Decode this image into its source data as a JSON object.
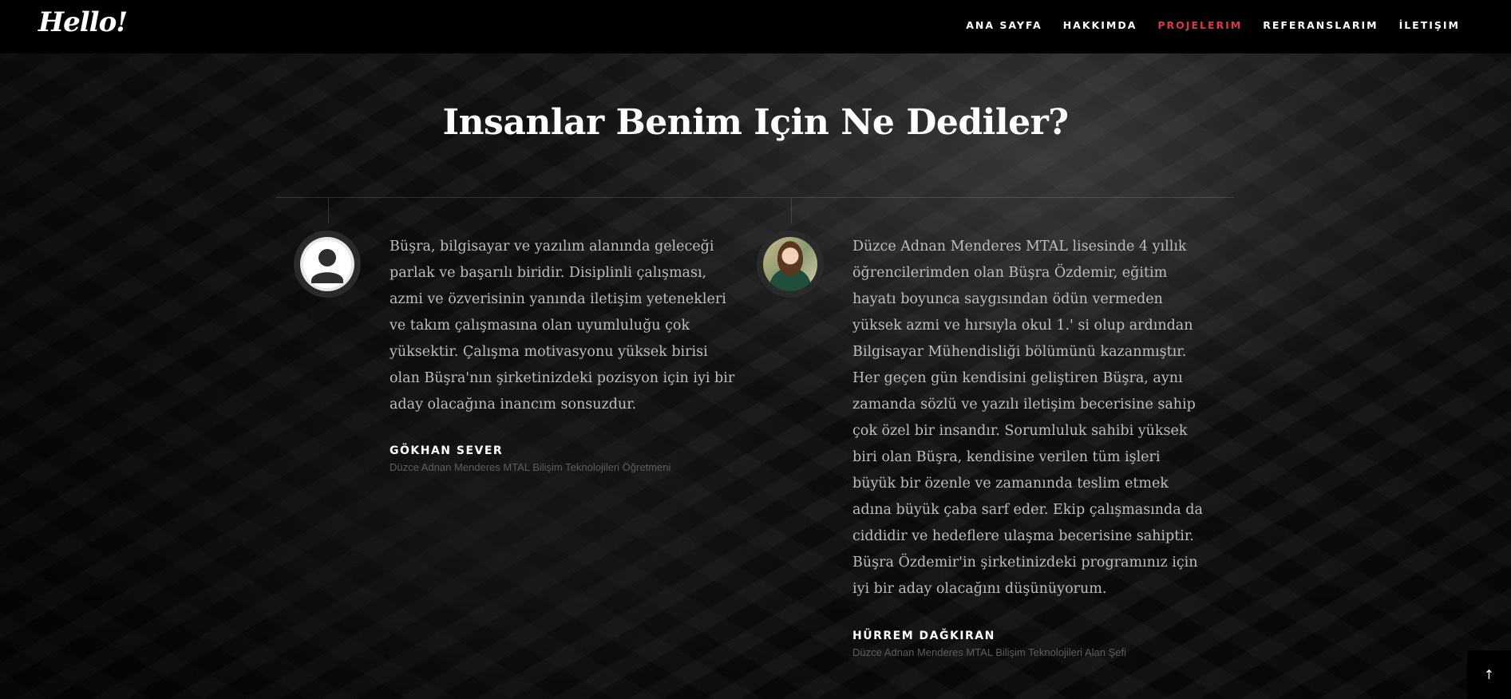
{
  "header": {
    "logo": "Hello!",
    "nav": [
      {
        "label": "ANA SAYFA",
        "active": false
      },
      {
        "label": "HAKKIMDA",
        "active": false
      },
      {
        "label": "PROJELERIM",
        "active": true
      },
      {
        "label": "REFERANSLARIM",
        "active": false
      },
      {
        "label": "İLETIŞIM",
        "active": false
      }
    ],
    "active_color": "#e0353b"
  },
  "section": {
    "title": "Insanlar Benim Için Ne Dediler?"
  },
  "testimonials": [
    {
      "avatar": "default-user-icon",
      "text": "Büşra, bilgisayar ve yazılım alanında geleceği parlak ve başarılı biridir. Disiplinli çalışması, azmi ve özverisinin yanında iletişim yetenekleri ve takım çalışmasına olan uyumluluğu çok yüksektir. Çalışma motivasyonu yüksek birisi olan Büşra'nın şirketinizdeki pozisyon için iyi bir aday olacağına inancım sonsuzdur.",
      "name": "GÖKHAN SEVER",
      "role": "Düzce Adnan Menderes MTAL Bilişim Teknolojileri Öğretmeni"
    },
    {
      "avatar": "profile-photo",
      "text": "Düzce Adnan Menderes MTAL lisesinde 4 yıllık öğrencilerimden olan Büşra Özdemir, eğitim hayatı boyunca saygısından ödün vermeden yüksek azmi ve hırsıyla okul 1.' si olup ardından Bilgisayar Mühendisliği bölümünü kazanmıştır. Her geçen gün kendisini geliştiren Büşra, aynı zamanda sözlü ve yazılı iletişim becerisine sahip çok özel bir insandır. Sorumluluk sahibi yüksek biri olan Büşra, kendisine verilen tüm işleri büyük bir özenle ve zamanında teslim etmek adına büyük çaba sarf eder. Ekip çalışmasında da ciddidir ve hedeflere ulaşma becerisine sahiptir. Büşra Özdemir'in şirketinizdeki programınız için iyi bir aday olacağını düşünüyorum.",
      "name": "HÜRREM DAĞKIRAN",
      "role": "Düzce Adnan Menderes MTAL Bilişim Teknolojileri Alan Şefi"
    }
  ],
  "scroll_top_icon": "arrow-up-icon"
}
